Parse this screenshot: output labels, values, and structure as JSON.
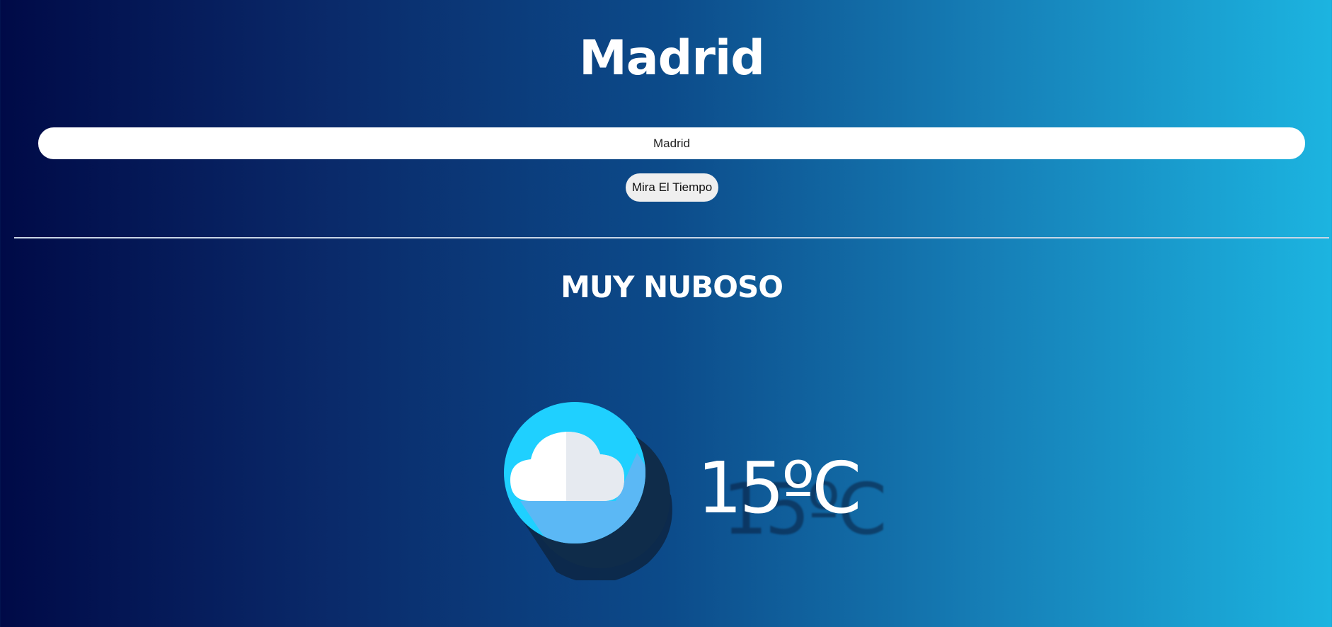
{
  "header": {
    "city": "Madrid"
  },
  "search": {
    "value": "Madrid",
    "button_label": "Mira El Tiempo"
  },
  "weather": {
    "condition": "MUY NUBOSO",
    "temperature": "15ºC",
    "icon": "cloud-icon"
  },
  "colors": {
    "gradient_start": "#000a47",
    "gradient_end": "#1cb4e0",
    "icon_circle": "#1fd0ff",
    "cloud": "#ffffff"
  }
}
